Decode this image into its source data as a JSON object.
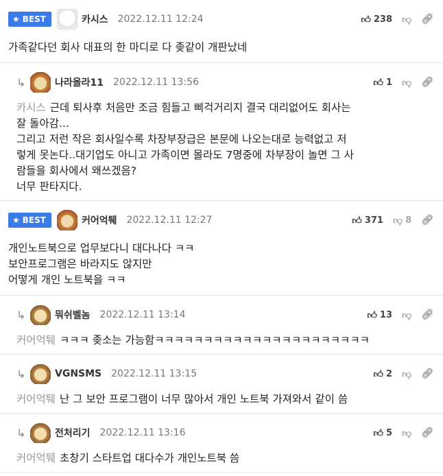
{
  "best_label": "BEST",
  "comments": [
    {
      "type": "best",
      "nick": "카시스",
      "date": "2022.12.11 12:24",
      "up": "238",
      "down": "",
      "lines": [
        "가족같다던 회사 대표의 한 마디로 다 좆같이 개판났네"
      ]
    },
    {
      "type": "reply",
      "nick": "나라올라11",
      "date": "2022.12.11 13:56",
      "up": "1",
      "down": "",
      "mention": "카시스",
      "lines": [
        "근데 퇴사후 처음만 조금 힘들고 삐걱거리지 결국 대리없어도 회사는",
        "잘 돌아감...",
        "그리고 저런 작은 회사일수록 차장부장급은 본문에 나오는대로 능력없고 저",
        "렇게 못논다..대기업도 아니고 가족이면 몰라도 7명중에 차부장이 놀면 그 사",
        "람들을 회사에서 왜쓰겠음?",
        "너무 판타지다."
      ]
    },
    {
      "type": "best",
      "nick": "커어억퉤",
      "date": "2022.12.11 12:27",
      "up": "371",
      "down": "8",
      "lines": [
        "개인노트북으로 업무보다니 대다나다 ㅋㅋ",
        "보안프로그램은 바라지도 않지만",
        "어떻게 개인 노트북을 ㅋㅋ"
      ]
    },
    {
      "type": "reply",
      "nick": "뭐쉬벨놈",
      "date": "2022.12.11 13:14",
      "up": "13",
      "down": "",
      "mention": "커어억퉤",
      "lines": [
        "ㅋㅋㅋ 좆소는 가능함ㅋㅋㅋㅋㅋㅋㅋㅋㅋㅋㅋㅋㅋㅋㅋㅋㅋㅋㅋㅋㅋㅋ"
      ]
    },
    {
      "type": "reply",
      "nick": "VGNSMS",
      "date": "2022.12.11 13:15",
      "up": "2",
      "down": "",
      "mention": "커어억퉤",
      "lines": [
        "난 그 보안 프로그램이 너무 많아서 개인 노트북 가져와서 같이 씀"
      ]
    },
    {
      "type": "reply",
      "nick": "전처리기",
      "date": "2022.12.11 13:16",
      "up": "5",
      "down": "",
      "mention": "커어억퉤",
      "lines": [
        "초창기 스타트업 대다수가 개인노트북 씀"
      ]
    }
  ]
}
